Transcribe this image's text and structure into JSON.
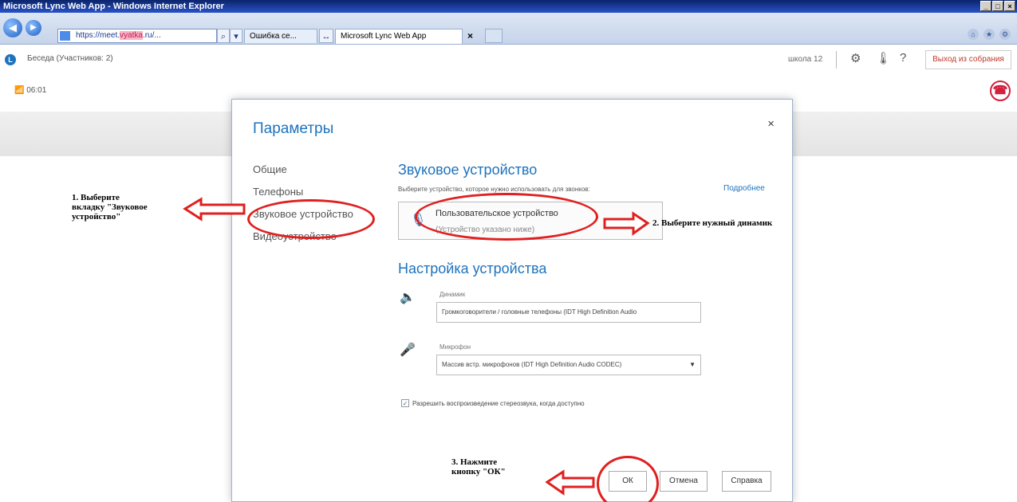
{
  "browser": {
    "window_title": "Microsoft Lync Web App - Windows Internet Explorer",
    "address": {
      "prefix": "https://meet.",
      "highlight": "vyatka",
      "suffix": ".ru/..."
    },
    "tabs": [
      {
        "label": "Ошибка се..."
      },
      {
        "label": "Microsoft Lync Web App"
      }
    ],
    "tab_close": "×",
    "nav_back": "◀",
    "nav_forward": "▶",
    "win_min": "_",
    "win_max": "□",
    "win_close": "×"
  },
  "appbar": {
    "conversation_label": "Беседа (Участников: 2)",
    "lync_logo": "L",
    "shot_label": "школа 12",
    "gear": "⚙",
    "temp": "🌡",
    "help": "?",
    "exit_label": "Выход из собрания"
  },
  "call": {
    "timer": "📶 06:01",
    "hangup": "☎"
  },
  "dialog": {
    "title": "Параметры",
    "close": "×",
    "nav": [
      "Общие",
      "Телефоны",
      "Звуковое устройство",
      "Видеоустройство"
    ],
    "audio_title": "Звуковое устройство",
    "audio_desc": "Выберите устройство, которое нужно использовать для звонков:",
    "more_link": "Подробнее",
    "device_name": "Пользовательское устройство",
    "device_note": "(Устройство указано ниже)",
    "setup_title": "Настройка устройства",
    "speaker_label": "Динамик",
    "speaker_value": "Громкоговорители / головные телефоны (IDT High Definition Audio",
    "mic_label": "Микрофон",
    "mic_value": "Массив встр. микрофонов (IDT High Definition Audio CODEC)",
    "stereo_label": "Разрешить воспроизведение стереозвука, когда доступно",
    "stereo_checked": "✓",
    "ok_label": "ОК",
    "cancel_label": "Отмена",
    "help_label": "Справка"
  },
  "annotations": {
    "step1": "1. Выберите\nвкладку \"Звуковое\nустройство\"",
    "step2": "2. Выберите нужный динамик",
    "step3": "3. Нажмите\nкнопку \"ОК\""
  },
  "colors": {
    "accent": "#1e73be",
    "annotation_red": "#e02020",
    "hangup_red": "#d21f3c"
  }
}
